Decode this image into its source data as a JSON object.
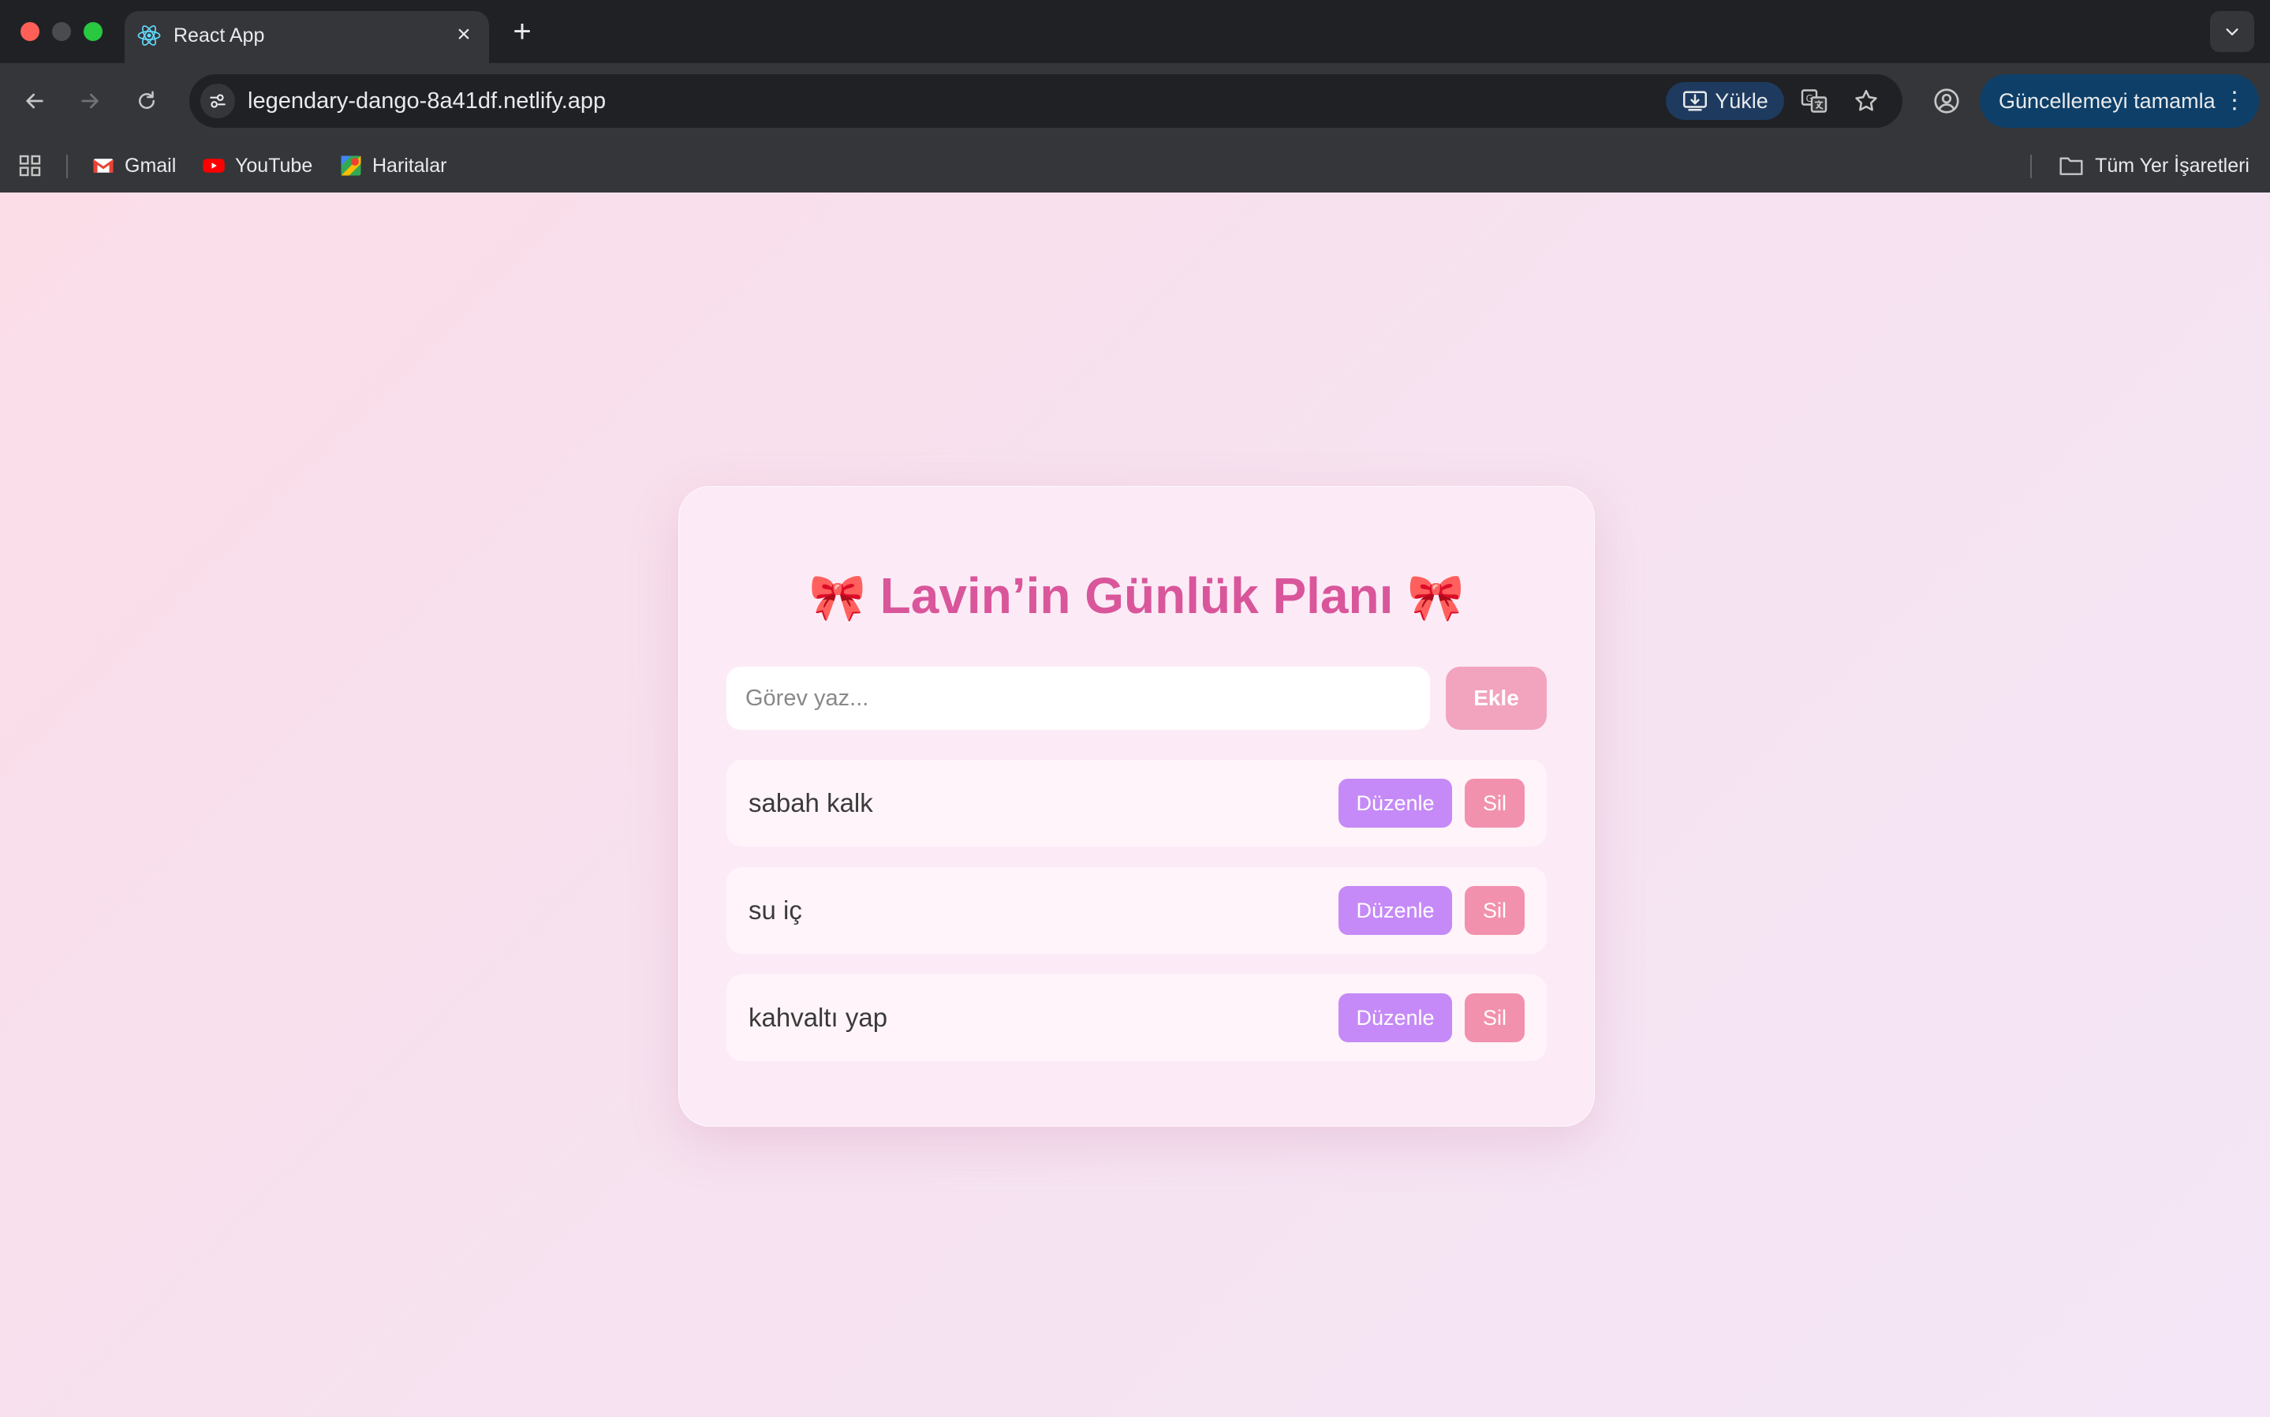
{
  "browser": {
    "tab_title": "React App",
    "new_tab_symbol": "+",
    "url": "legendary-dango-8a41df.netlify.app",
    "install_label": "Yükle",
    "update_label": "Güncellemeyi tamamla",
    "bookmarks": [
      {
        "label": "Gmail",
        "icon": "gmail-icon"
      },
      {
        "label": "YouTube",
        "icon": "youtube-icon"
      },
      {
        "label": "Haritalar",
        "icon": "maps-icon"
      }
    ],
    "all_bookmarks_label": "Tüm Yer İşaretleri"
  },
  "app": {
    "title_text": "Lavin’in Günlük Planı",
    "title_emoji": "🎀",
    "input_placeholder": "Görev yaz...",
    "add_button": "Ekle",
    "tasks": [
      {
        "text": "sabah kalk",
        "edit_label": "Düzenle",
        "delete_label": "Sil"
      },
      {
        "text": "su iç",
        "edit_label": "Düzenle",
        "delete_label": "Sil"
      },
      {
        "text": "kahvaltı yap",
        "edit_label": "Düzenle",
        "delete_label": "Sil"
      }
    ]
  },
  "colors": {
    "title": "#d9569b",
    "edit_button": "#c58af7",
    "delete_button": "#f291ad",
    "add_button": "#f2a3bd"
  }
}
